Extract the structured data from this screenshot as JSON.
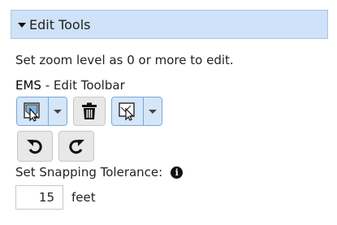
{
  "panel": {
    "title": "Edit Tools"
  },
  "messages": {
    "zoom_hint": "Set zoom level as 0 or more to edit."
  },
  "toolbar": {
    "prefix": "EMS",
    "title": " - Edit Toolbar",
    "buttons": {
      "edit_feature_icon": "edit-feature-icon",
      "delete_icon": "trash-icon",
      "select_icon": "select-feature-icon",
      "undo_icon": "undo-icon",
      "redo_icon": "redo-icon"
    }
  },
  "snapping": {
    "label": "Set Snapping Tolerance:",
    "value": "15",
    "unit": "feet"
  },
  "colors": {
    "header_bg": "#cfe2f7",
    "split_bg": "#d5e6f8",
    "button_bg": "#e8e8e8"
  }
}
